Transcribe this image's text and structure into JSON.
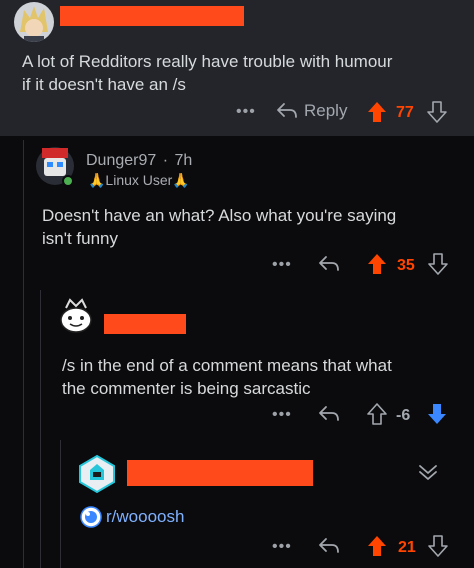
{
  "colors": {
    "upvote": "#ff4500",
    "downvote": "#3a87ff",
    "redaction": "#ff4a1c",
    "link": "#7fb1ff"
  },
  "comment1": {
    "text_line1": "A lot of Redditors really have trouble with humour",
    "text_line2": "if it doesn't have an /s",
    "reply_label": "Reply",
    "score": "77",
    "more_label": "•••"
  },
  "comment2": {
    "username": "Dunger97",
    "separator": "·",
    "age": "7h",
    "flair": "🙏Linux User🙏",
    "text_line1": "Doesn't have an what? Also what you're saying",
    "text_line2": "isn't funny",
    "score": "35",
    "more_label": "•••"
  },
  "comment3": {
    "text_line1": "/s in the end of a comment means that what",
    "text_line2": "the commenter is being sarcastic",
    "score": "-6",
    "more_label": "•••"
  },
  "comment4": {
    "community_link": "r/woooosh",
    "score": "21",
    "more_label": "•••"
  }
}
